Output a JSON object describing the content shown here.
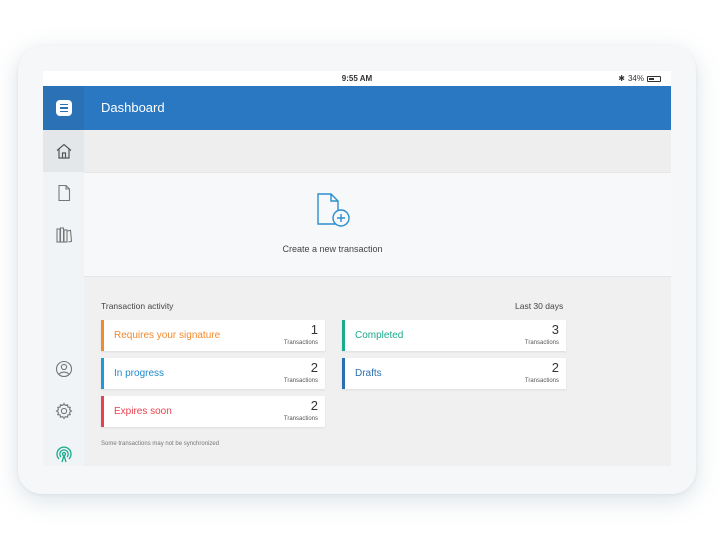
{
  "status_bar": {
    "time": "9:55 AM",
    "battery": "34%"
  },
  "header": {
    "title": "Dashboard"
  },
  "create": {
    "label": "Create a new transaction"
  },
  "activity": {
    "title": "Transaction activity",
    "period": "Last 30 days",
    "cards": [
      {
        "label": "Requires your signature",
        "count": "1",
        "unit": "Transactions",
        "color": "#f28a2e"
      },
      {
        "label": "In progress",
        "count": "2",
        "unit": "Transactions",
        "color": "#1f9ad6"
      },
      {
        "label": "Expires soon",
        "count": "2",
        "unit": "Transactions",
        "color": "#e8424e"
      },
      {
        "label": "Completed",
        "count": "3",
        "unit": "Transactions",
        "color": "#1aaa8c"
      },
      {
        "label": "Drafts",
        "count": "2",
        "unit": "Transactions",
        "color": "#2a6faf"
      }
    ],
    "footnote": "Some transactions may not be synchronized"
  },
  "colors": {
    "header": "#2a78c2",
    "menu_tile": "#2a72b5",
    "accent_icon": "#2a8fd0",
    "sync_icon": "#1aaa8c"
  },
  "icons": {
    "menu": "menu-icon",
    "home": "home-icon",
    "documents": "document-icon",
    "library": "library-icon",
    "profile": "user-icon",
    "settings": "gear-icon",
    "sync": "wireless-sync-icon",
    "new_transaction": "document-plus-icon"
  }
}
